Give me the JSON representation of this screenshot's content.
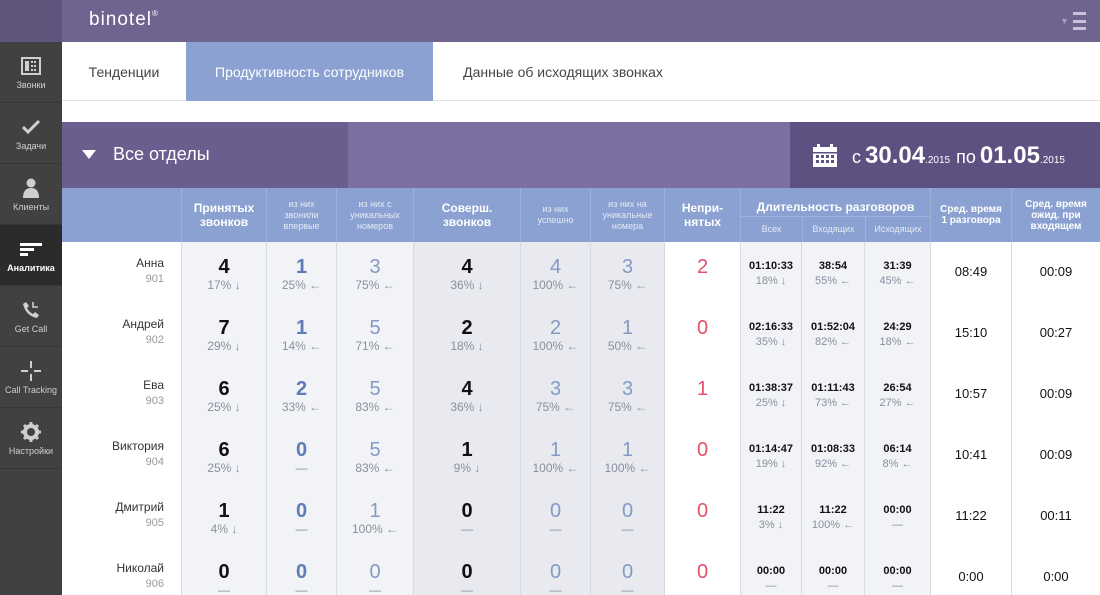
{
  "app": {
    "logo": "binotel",
    "logo_mark": "®"
  },
  "sidebar": {
    "items": [
      {
        "label": "Звонки",
        "icon": "phone-grid-icon"
      },
      {
        "label": "Задачи",
        "icon": "checkmark-icon"
      },
      {
        "label": "Клиенты",
        "icon": "user-icon"
      },
      {
        "label": "Аналитика",
        "icon": "analytics-icon",
        "active": true
      },
      {
        "label": "Get Call",
        "icon": "get-call-icon"
      },
      {
        "label": "Call Tracking",
        "icon": "crosshair-icon"
      },
      {
        "label": "Настройки",
        "icon": "gear-icon"
      }
    ]
  },
  "tabs": [
    {
      "label": "Тенденции"
    },
    {
      "label": "Продуктивность сотрудников",
      "active": true
    },
    {
      "label": "Данные об исходящих звонках"
    }
  ],
  "filter": {
    "department": "Все отделы",
    "date_from_word": "с",
    "date_from": "30.04",
    "date_from_year": ".2015",
    "date_to_word": "по",
    "date_to": "01.05",
    "date_to_year": ".2015"
  },
  "table": {
    "headers": {
      "accepted": "Принятых звонков",
      "accepted_first": "из них звонили впервые",
      "accepted_unique": "из них с уникальных номеров",
      "made": "Соверш. звонков",
      "made_success": "из них успешно",
      "made_unique": "из них на уникальные номера",
      "missed": "Непри-нятых",
      "duration": "Длительность разговоров",
      "dur_all": "Всех",
      "dur_in": "Входящих",
      "dur_out": "Исходящих",
      "avg_talk": "Сред. время 1 разговора",
      "avg_wait": "Сред. время ожид. при входящем"
    },
    "rows": [
      {
        "name": "Анна",
        "ext": "901",
        "acc": "4",
        "acc_p": "17% ↓",
        "first": "1",
        "first_p": "25% ←",
        "uniq": "3",
        "uniq_p": "75% ←",
        "made": "4",
        "made_p": "36% ↓",
        "succ": "4",
        "succ_p": "100% ←",
        "muniq": "3",
        "muniq_p": "75% ←",
        "missed": "2",
        "d_all": "01:10:33",
        "d_all_p": "18% ↓",
        "d_in": "38:54",
        "d_in_p": "55% ←",
        "d_out": "31:39",
        "d_out_p": "45% ←",
        "avg_talk": "08:49",
        "avg_wait": "00:09"
      },
      {
        "name": "Андрей",
        "ext": "902",
        "acc": "7",
        "acc_p": "29% ↓",
        "first": "1",
        "first_p": "14% ←",
        "uniq": "5",
        "uniq_p": "71% ←",
        "made": "2",
        "made_p": "18% ↓",
        "succ": "2",
        "succ_p": "100% ←",
        "muniq": "1",
        "muniq_p": "50% ←",
        "missed": "0",
        "d_all": "02:16:33",
        "d_all_p": "35% ↓",
        "d_in": "01:52:04",
        "d_in_p": "82% ←",
        "d_out": "24:29",
        "d_out_p": "18% ←",
        "avg_talk": "15:10",
        "avg_wait": "00:27"
      },
      {
        "name": "Ева",
        "ext": "903",
        "acc": "6",
        "acc_p": "25% ↓",
        "first": "2",
        "first_p": "33% ←",
        "uniq": "5",
        "uniq_p": "83% ←",
        "made": "4",
        "made_p": "36% ↓",
        "succ": "3",
        "succ_p": "75% ←",
        "muniq": "3",
        "muniq_p": "75% ←",
        "missed": "1",
        "d_all": "01:38:37",
        "d_all_p": "25% ↓",
        "d_in": "01:11:43",
        "d_in_p": "73% ←",
        "d_out": "26:54",
        "d_out_p": "27% ←",
        "avg_talk": "10:57",
        "avg_wait": "00:09"
      },
      {
        "name": "Виктория",
        "ext": "904",
        "acc": "6",
        "acc_p": "25% ↓",
        "first": "0",
        "first_p": "—",
        "uniq": "5",
        "uniq_p": "83% ←",
        "made": "1",
        "made_p": "9% ↓",
        "succ": "1",
        "succ_p": "100% ←",
        "muniq": "1",
        "muniq_p": "100% ←",
        "missed": "0",
        "d_all": "01:14:47",
        "d_all_p": "19% ↓",
        "d_in": "01:08:33",
        "d_in_p": "92% ←",
        "d_out": "06:14",
        "d_out_p": "8% ←",
        "avg_talk": "10:41",
        "avg_wait": "00:09"
      },
      {
        "name": "Дмитрий",
        "ext": "905",
        "acc": "1",
        "acc_p": "4% ↓",
        "first": "0",
        "first_p": "—",
        "uniq": "1",
        "uniq_p": "100% ←",
        "made": "0",
        "made_p": "—",
        "succ": "0",
        "succ_p": "—",
        "muniq": "0",
        "muniq_p": "—",
        "missed": "0",
        "d_all": "11:22",
        "d_all_p": "3% ↓",
        "d_in": "11:22",
        "d_in_p": "100% ←",
        "d_out": "00:00",
        "d_out_p": "—",
        "avg_talk": "11:22",
        "avg_wait": "00:11"
      },
      {
        "name": "Николай",
        "ext": "906",
        "acc": "0",
        "acc_p": "—",
        "first": "0",
        "first_p": "—",
        "uniq": "0",
        "uniq_p": "—",
        "made": "0",
        "made_p": "—",
        "succ": "0",
        "succ_p": "—",
        "muniq": "0",
        "muniq_p": "—",
        "missed": "0",
        "d_all": "00:00",
        "d_all_p": "—",
        "d_in": "00:00",
        "d_in_p": "—",
        "d_out": "00:00",
        "d_out_p": "—",
        "avg_talk": "0:00",
        "avg_wait": "0:00"
      }
    ]
  }
}
